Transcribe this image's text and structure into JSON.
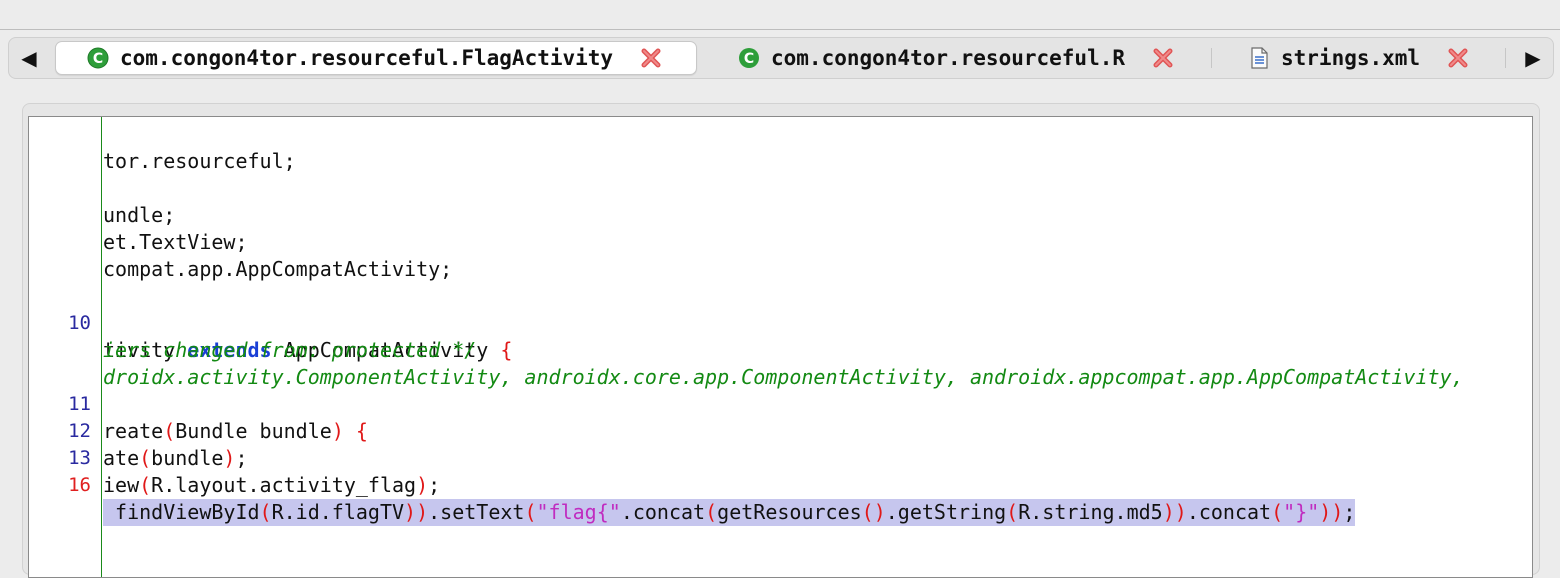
{
  "tabs": [
    {
      "label": "com.congon4tor.resourceful.FlagActivity",
      "icon": "java-class-icon",
      "active": true
    },
    {
      "label": "com.congon4tor.resourceful.R",
      "icon": "java-class-icon",
      "active": false
    },
    {
      "label": "strings.xml",
      "icon": "xml-file-icon",
      "active": false
    }
  ],
  "nav": {
    "left": "◀",
    "right": "▶"
  },
  "code": {
    "line1": "tor.resourceful;",
    "line3": "undle;",
    "line4": "et.TextView;",
    "line5": "compat.app.AppCompatActivity;",
    "line7": {
      "num": "10",
      "a": "tivity ",
      "kw": "extends",
      "b": " AppCompatActivity ",
      "brace": "{"
    },
    "line8": "iers changed from: protected */",
    "line9": "droidx.activity.ComponentActivity, androidx.core.app.ComponentActivity, androidx.appcompat.app.AppCompatActivity,",
    "line10": {
      "num": "11",
      "a": "reate",
      "p1": "(",
      "b": "Bundle bundle",
      "p2": ")",
      "c": " ",
      "brace": "{"
    },
    "line11": {
      "num": "12",
      "a": "ate",
      "p1": "(",
      "b": "bundle",
      "p2": ")",
      "c": ";"
    },
    "line12": {
      "num": "13",
      "a": "iew",
      "p1": "(",
      "b": "R.layout.activity_flag",
      "p2": ")",
      "c": ";"
    },
    "line13": {
      "num": "16",
      "a": " findViewById",
      "p1": "(",
      "b": "R.id.flagTV",
      "p2": "))",
      "c": ".setText",
      "p3": "(",
      "s1": "\"flag{\"",
      "d": ".concat",
      "p4": "(",
      "e": "getResources",
      "p5": "()",
      "f": ".getString",
      "p6": "(",
      "g": "R.string.md5",
      "p7": "))",
      "h": ".concat",
      "p8": "(",
      "s2": "\"}\"",
      "p9": "))",
      "i": ";"
    }
  }
}
